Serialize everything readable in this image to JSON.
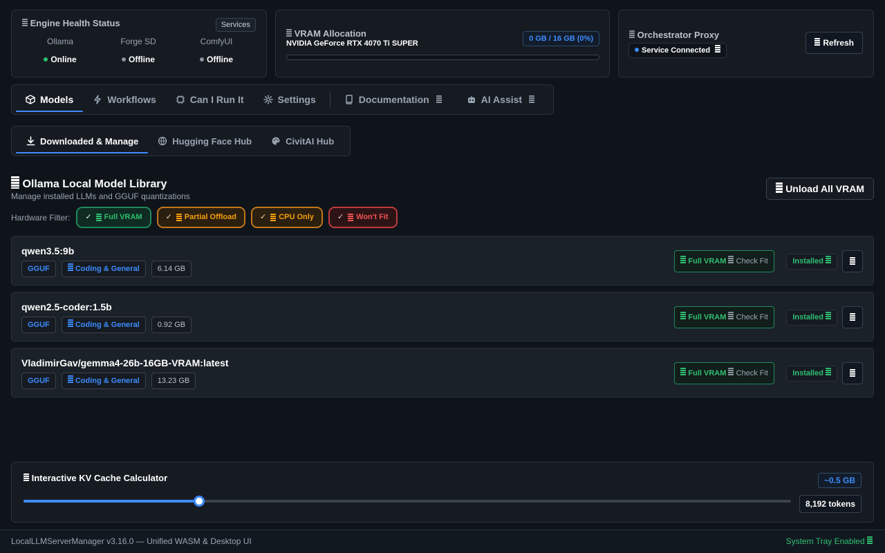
{
  "engine": {
    "title": "Engine Health Status",
    "services_label": "Services",
    "items": [
      {
        "name": "Ollama",
        "status": "Online",
        "color": "#2fbf71"
      },
      {
        "name": "Forge SD",
        "status": "Offline",
        "color": "#8b949e"
      },
      {
        "name": "ComfyUI",
        "status": "Offline",
        "color": "#8b949e"
      }
    ]
  },
  "vram": {
    "title": "VRAM Allocation",
    "gpu": "NVIDIA GeForce RTX 4070 Ti SUPER",
    "usage": "0 GB / 16 GB (0%)",
    "percent": 0
  },
  "proxy": {
    "title": "Orchestrator Proxy",
    "status": "Service Connected",
    "refresh_label": "Refresh"
  },
  "nav": {
    "tabs": [
      {
        "label": "Models",
        "icon": "cube-icon"
      },
      {
        "label": "Workflows",
        "icon": "bolt-icon"
      },
      {
        "label": "Can I Run It",
        "icon": "chip-icon"
      },
      {
        "label": "Settings",
        "icon": "gear-icon"
      },
      {
        "label": "Documentation",
        "icon": "book-icon"
      },
      {
        "label": "AI Assist",
        "icon": "robot-icon"
      }
    ]
  },
  "subnav": {
    "tabs": [
      {
        "label": "Downloaded & Manage",
        "icon": "download-icon"
      },
      {
        "label": "Hugging Face Hub",
        "icon": "globe-icon"
      },
      {
        "label": "CivitAI Hub",
        "icon": "palette-icon"
      }
    ]
  },
  "library": {
    "title": "Ollama Local Model Library",
    "subtitle": "Manage installed LLMs and GGUF quantizations",
    "unload_label": "Unload All VRAM",
    "filter_label": "Hardware Filter:",
    "filters": [
      {
        "label": "Full VRAM"
      },
      {
        "label": "Partial Offload"
      },
      {
        "label": "CPU Only"
      },
      {
        "label": "Won't Fit"
      }
    ],
    "models": [
      {
        "name": "qwen3.5:9b",
        "format": "GGUF",
        "category": "Coding & General",
        "size": "6.14 GB",
        "fit": "Full VRAM",
        "check": "Check Fit",
        "status": "Installed"
      },
      {
        "name": "qwen2.5-coder:1.5b",
        "format": "GGUF",
        "category": "Coding & General",
        "size": "0.92 GB",
        "fit": "Full VRAM",
        "check": "Check Fit",
        "status": "Installed"
      },
      {
        "name": "VladimirGav/gemma4-26b-16GB-VRAM:latest",
        "format": "GGUF",
        "category": "Coding & General",
        "size": "13.23 GB",
        "fit": "Full VRAM",
        "check": "Check Fit",
        "status": "Installed"
      }
    ]
  },
  "kv": {
    "title": "Interactive KV Cache Calculator",
    "estimate": "~0.5 GB",
    "tokens": "8,192 tokens",
    "slider_fraction": 0.229
  },
  "footer": {
    "version": "LocalLLMServerManager v3.16.0 — Unified WASM & Desktop UI",
    "tray": "System Tray Enabled"
  },
  "colors": {
    "accent": "#3d8bfd",
    "success": "#2fbf71",
    "warning": "#f59e0b",
    "danger": "#f05252",
    "background": "#0f141b"
  }
}
